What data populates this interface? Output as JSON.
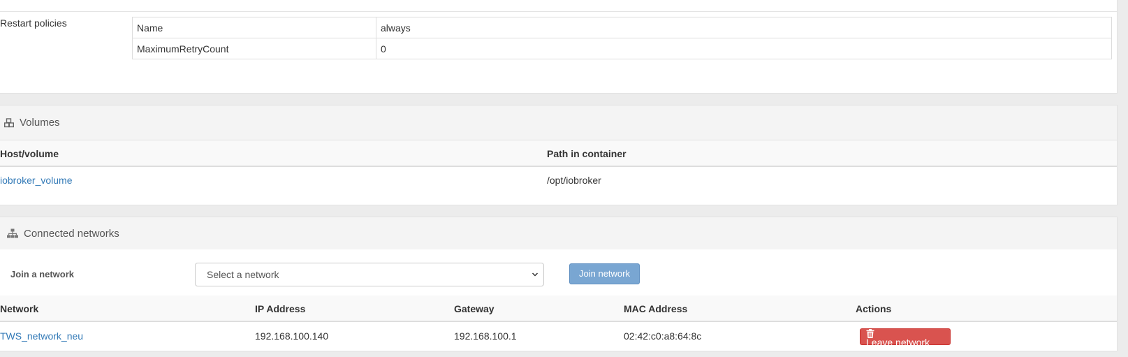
{
  "restart": {
    "label": "Restart policies",
    "rows": [
      {
        "key": "Name",
        "value": "always"
      },
      {
        "key": "MaximumRetryCount",
        "value": "0"
      }
    ]
  },
  "volumes": {
    "title": "Volumes",
    "icon": "cubes-icon",
    "columns": [
      "Host/volume",
      "Path in container"
    ],
    "rows": [
      {
        "host": "iobroker_volume",
        "path": "/opt/iobroker"
      }
    ]
  },
  "networks": {
    "title": "Connected networks",
    "icon": "sitemap-icon",
    "join_label": "Join a network",
    "select_placeholder": "Select a network",
    "join_button": "Join network",
    "columns": [
      "Network",
      "IP Address",
      "Gateway",
      "MAC Address",
      "Actions"
    ],
    "rows": [
      {
        "network": "TWS_network_neu",
        "ip": "192.168.100.140",
        "gateway": "192.168.100.1",
        "mac": "02:42:c0:a8:64:8c",
        "action": "Leave network"
      }
    ]
  },
  "colors": {
    "link": "#337ab7",
    "danger": "#d9534f",
    "primary_disabled": "#79a6d2"
  }
}
